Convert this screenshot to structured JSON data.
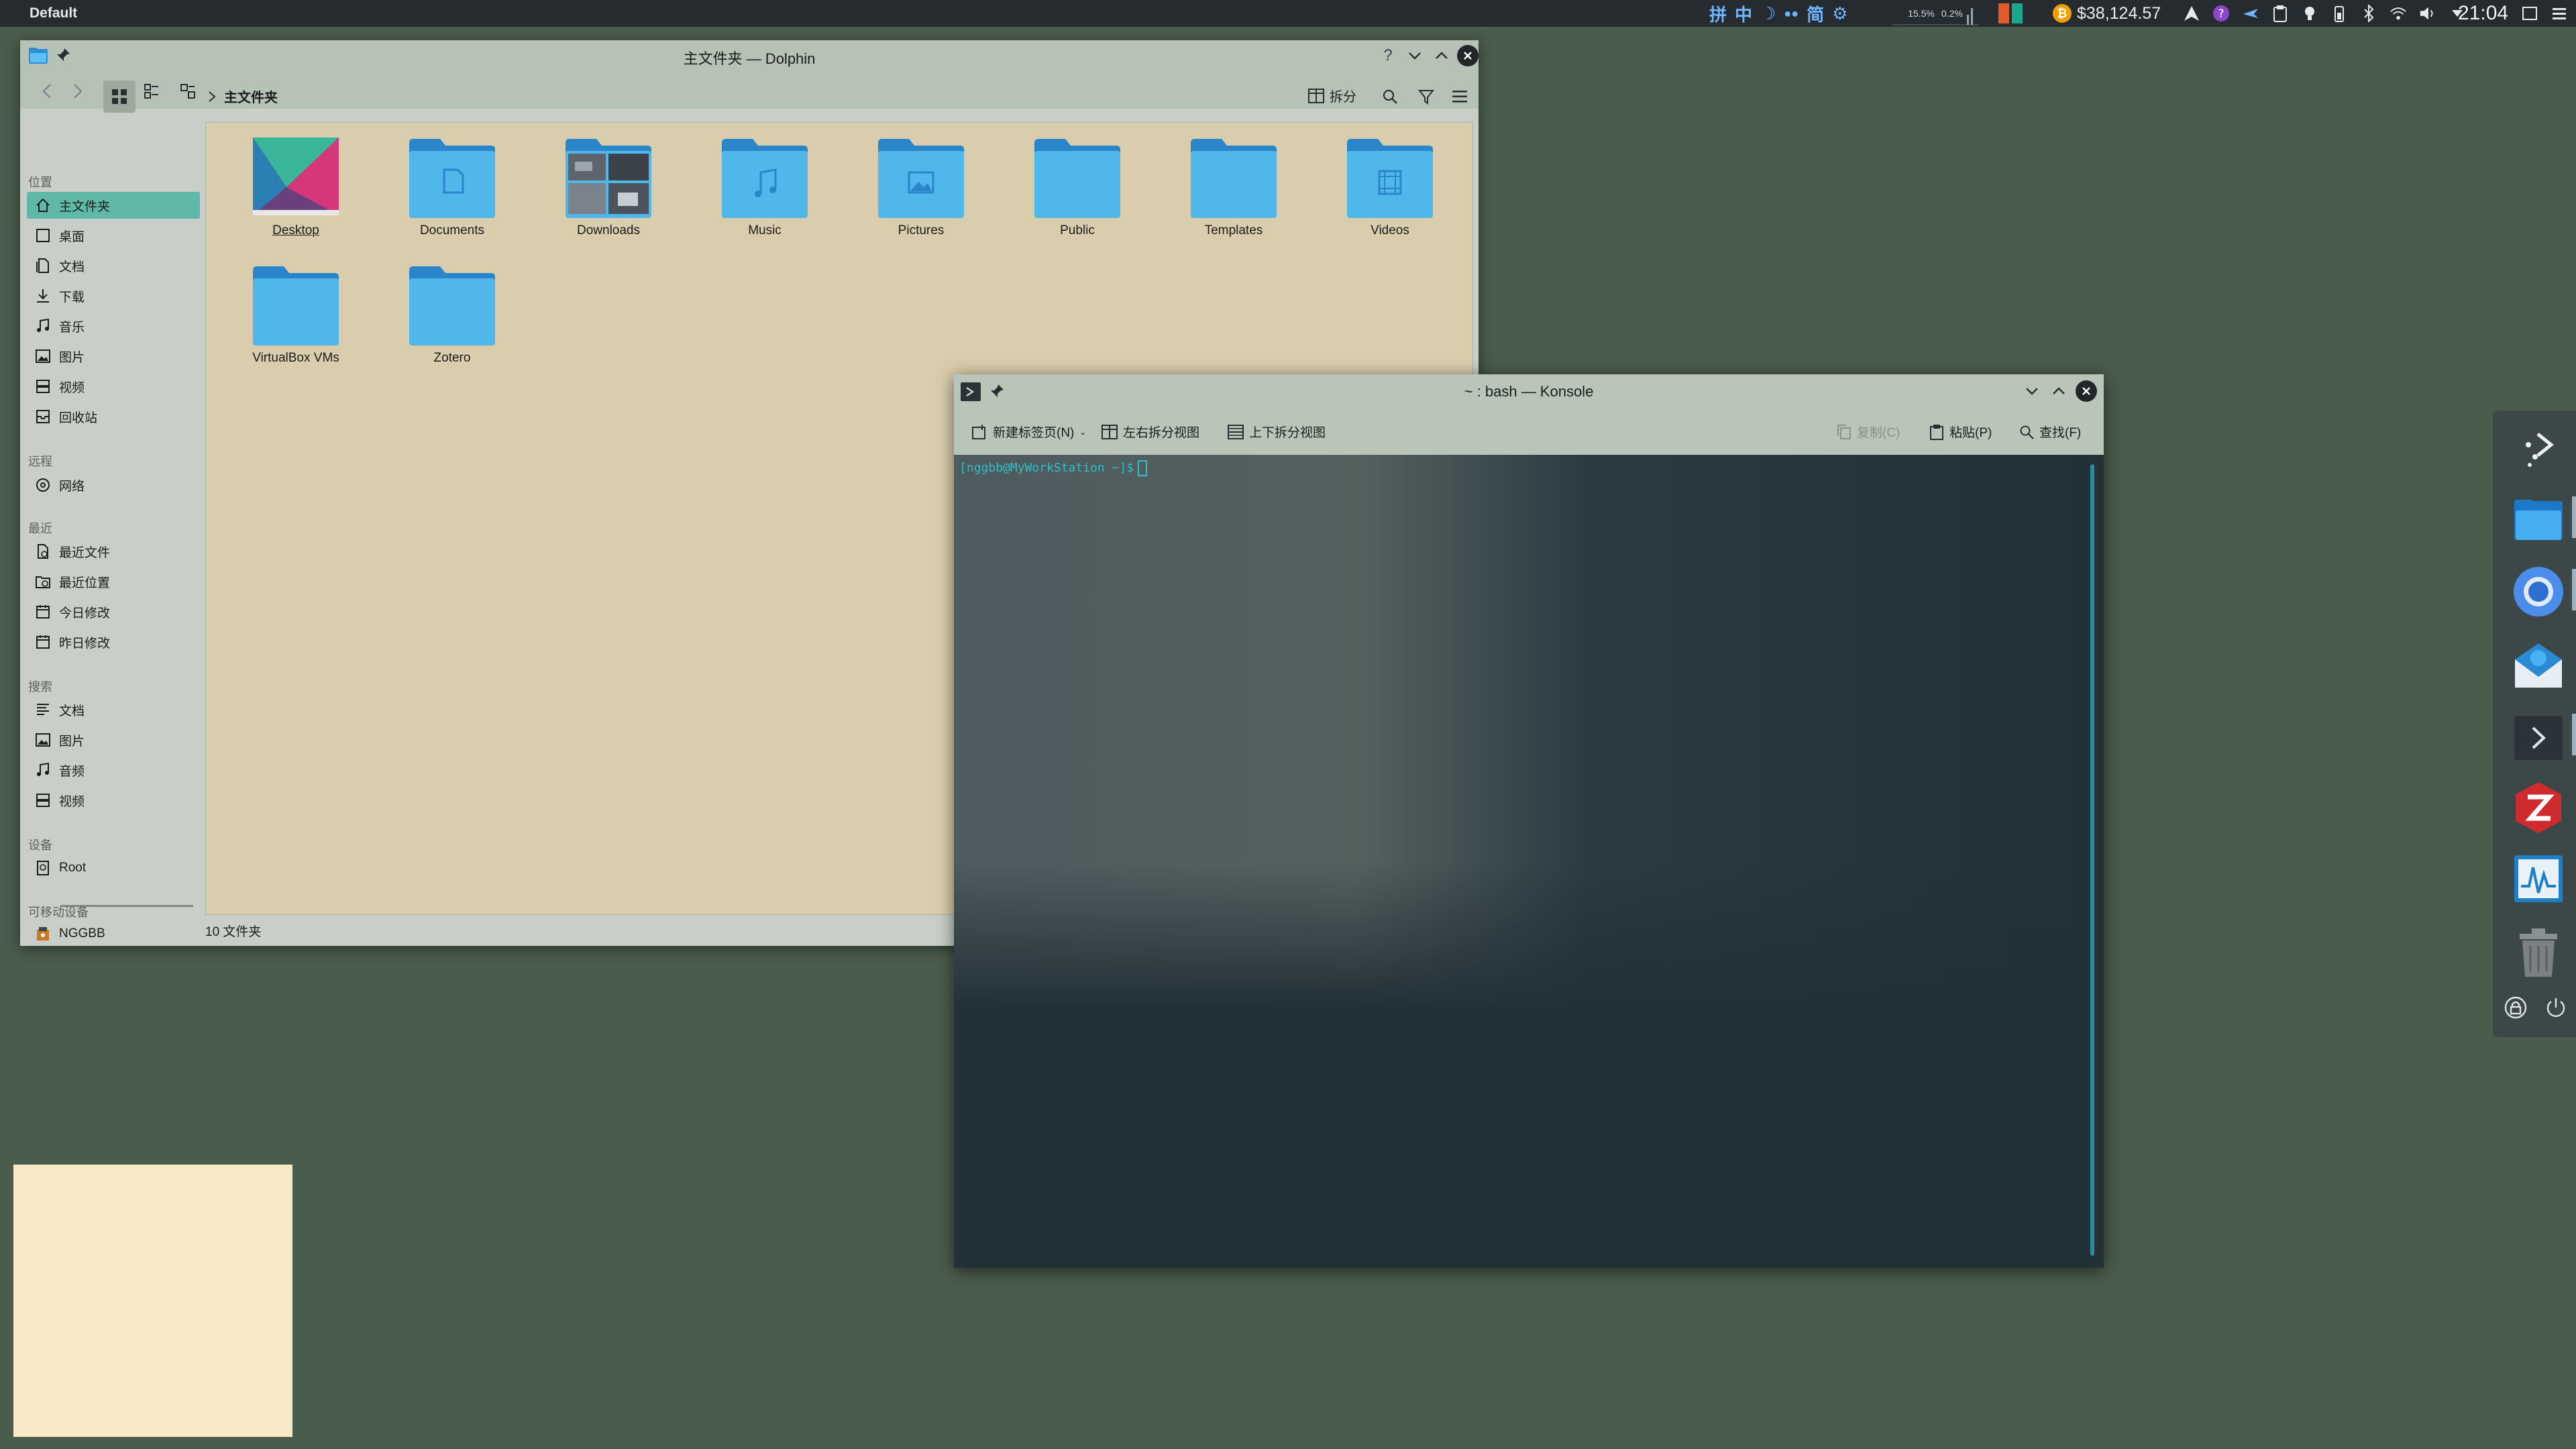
{
  "panel": {
    "activity": "Default",
    "ime": [
      "拼",
      "中",
      "简"
    ],
    "cpu_label": "15.5%",
    "cpu2_label": "0.2%",
    "btc_price": "$38,124.57",
    "clock": "21:04"
  },
  "dolphin": {
    "title": "主文件夹 — Dolphin",
    "breadcrumb": "主文件夹",
    "split_label": "拆分",
    "sidebar": {
      "sections": {
        "places": "位置",
        "remote": "远程",
        "recent": "最近",
        "search": "搜索",
        "devices": "设备",
        "removable": "可移动设备"
      },
      "places": [
        {
          "label": "主文件夹",
          "icon": "home-icon"
        },
        {
          "label": "桌面",
          "icon": "desktop-icon"
        },
        {
          "label": "文档",
          "icon": "documents-icon"
        },
        {
          "label": "下载",
          "icon": "download-icon"
        },
        {
          "label": "音乐",
          "icon": "music-icon"
        },
        {
          "label": "图片",
          "icon": "pictures-icon"
        },
        {
          "label": "视频",
          "icon": "videos-icon"
        },
        {
          "label": "回收站",
          "icon": "trash-icon"
        }
      ],
      "remote": [
        {
          "label": "网络",
          "icon": "network-icon"
        }
      ],
      "recent": [
        {
          "label": "最近文件",
          "icon": "recent-files-icon"
        },
        {
          "label": "最近位置",
          "icon": "recent-locations-icon"
        },
        {
          "label": "今日修改",
          "icon": "calendar-icon"
        },
        {
          "label": "昨日修改",
          "icon": "calendar-icon"
        }
      ],
      "search": [
        {
          "label": "文档",
          "icon": "documents-icon"
        },
        {
          "label": "图片",
          "icon": "pictures-icon"
        },
        {
          "label": "音频",
          "icon": "music-icon"
        },
        {
          "label": "视频",
          "icon": "videos-icon"
        }
      ],
      "devices": [
        {
          "label": "Root",
          "icon": "drive-icon"
        }
      ],
      "removable": [
        {
          "label": "NGGBB",
          "icon": "usb-icon"
        }
      ]
    },
    "files": [
      {
        "name": "Desktop",
        "kind": "desktop"
      },
      {
        "name": "Documents",
        "kind": "documents"
      },
      {
        "name": "Downloads",
        "kind": "downloads"
      },
      {
        "name": "Music",
        "kind": "music"
      },
      {
        "name": "Pictures",
        "kind": "pictures"
      },
      {
        "name": "Public",
        "kind": "plain"
      },
      {
        "name": "Templates",
        "kind": "plain"
      },
      {
        "name": "Videos",
        "kind": "videos"
      },
      {
        "name": "VirtualBox VMs",
        "kind": "plain"
      },
      {
        "name": "Zotero",
        "kind": "plain"
      }
    ],
    "status": "10 文件夹"
  },
  "konsole": {
    "title": "~ : bash — Konsole",
    "toolbar": {
      "new_tab": "新建标签页(N)",
      "split_lr": "左右拆分视图",
      "split_tb": "上下拆分视图",
      "copy": "复制(C)",
      "paste": "粘贴(P)",
      "find": "查找(F)"
    },
    "prompt": "[nggbb@MyWorkStation ~]$"
  },
  "dock": {
    "items": [
      "kickoff-icon",
      "file-manager-icon",
      "chromium-icon",
      "mail-icon",
      "terminal-icon",
      "zotero-icon",
      "system-monitor-icon",
      "trash-icon"
    ]
  },
  "colors": {
    "desktop": "#4a5c4c",
    "accent": "#5fb8a8",
    "folder": "#4fb7ea",
    "terminal_bg": "#223038",
    "prompt": "#2fbfc4"
  }
}
